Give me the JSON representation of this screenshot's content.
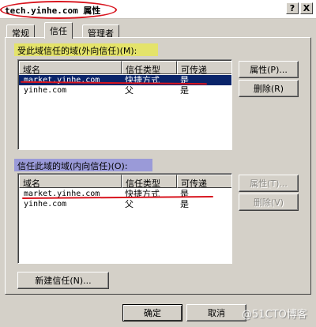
{
  "window": {
    "title": "tech.yinhe.com 属性",
    "help_label": "?",
    "close_label": "X"
  },
  "tabs": [
    {
      "label": "常规"
    },
    {
      "label": "信任"
    },
    {
      "label": "管理者"
    }
  ],
  "outgoing": {
    "label": "受此域信任的域(外向信任)(M):",
    "columns": [
      "域名",
      "信任类型",
      "可传递"
    ],
    "rows": [
      {
        "domain": "market.yinhe.com",
        "type": "快捷方式",
        "transitive": "是"
      },
      {
        "domain": "yinhe.com",
        "type": "父",
        "transitive": "是"
      }
    ],
    "properties_label": "属性(P)...",
    "remove_label": "删除(R)"
  },
  "incoming": {
    "label": "信任此域的域(内向信任)(O):",
    "columns": [
      "域名",
      "信任类型",
      "可传递"
    ],
    "rows": [
      {
        "domain": "market.yinhe.com",
        "type": "快捷方式",
        "transitive": "是"
      },
      {
        "domain": "yinhe.com",
        "type": "父",
        "transitive": "是"
      }
    ],
    "properties_label": "属性(T)...",
    "remove_label": "删除(V)"
  },
  "new_trust_label": "新建信任(N)...",
  "footer": {
    "ok_label": "确定",
    "cancel_label": "取消"
  },
  "watermark": "@51CTO博客",
  "colors": {
    "dialog_bg": "#d4d0c8",
    "selection": "#0a246a",
    "highlight_outgoing": "#e4e36a",
    "highlight_incoming": "#9a9ad8",
    "annotation_red": "#d8141e"
  }
}
